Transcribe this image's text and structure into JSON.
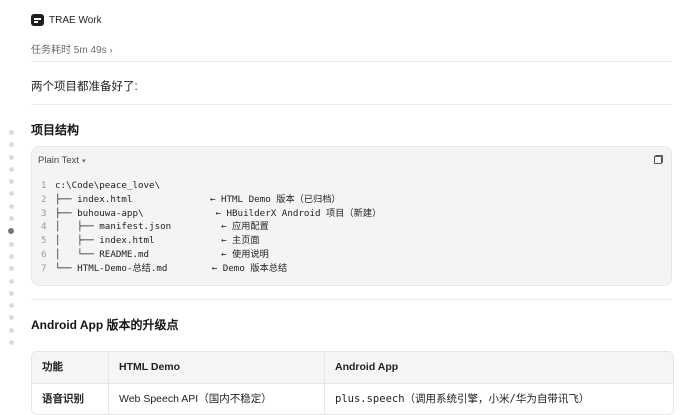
{
  "app": {
    "name": "TRAE Work"
  },
  "task": {
    "elapsed": "任务耗时 5m 49s"
  },
  "message": {
    "intro": "两个项目都准备好了:"
  },
  "section1": {
    "title": "项目结构"
  },
  "code_block": {
    "language": "Plain Text",
    "lines": [
      {
        "num": "1",
        "text": "c:\\Code\\peace_love\\"
      },
      {
        "num": "2",
        "text": "├── index.html              ← HTML Demo 版本（已归档）"
      },
      {
        "num": "3",
        "text": "├── buhouwa-app\\             ← HBuilderX Android 项目（新建）"
      },
      {
        "num": "4",
        "text": "│   ├── manifest.json         ← 应用配置"
      },
      {
        "num": "5",
        "text": "│   ├── index.html            ← 主页面"
      },
      {
        "num": "6",
        "text": "│   └── README.md             ← 使用说明"
      },
      {
        "num": "7",
        "text": "└── HTML-Demo-总结.md        ← Demo 版本总结"
      }
    ]
  },
  "section2": {
    "title": "Android App 版本的升级点"
  },
  "table": {
    "headers": [
      "功能",
      "HTML Demo",
      "Android App"
    ],
    "rows": [
      [
        "语音识别",
        "Web Speech API（国内不稳定）",
        "plus.speech（调用系统引擎，小米/华为自带讯飞）"
      ]
    ]
  }
}
